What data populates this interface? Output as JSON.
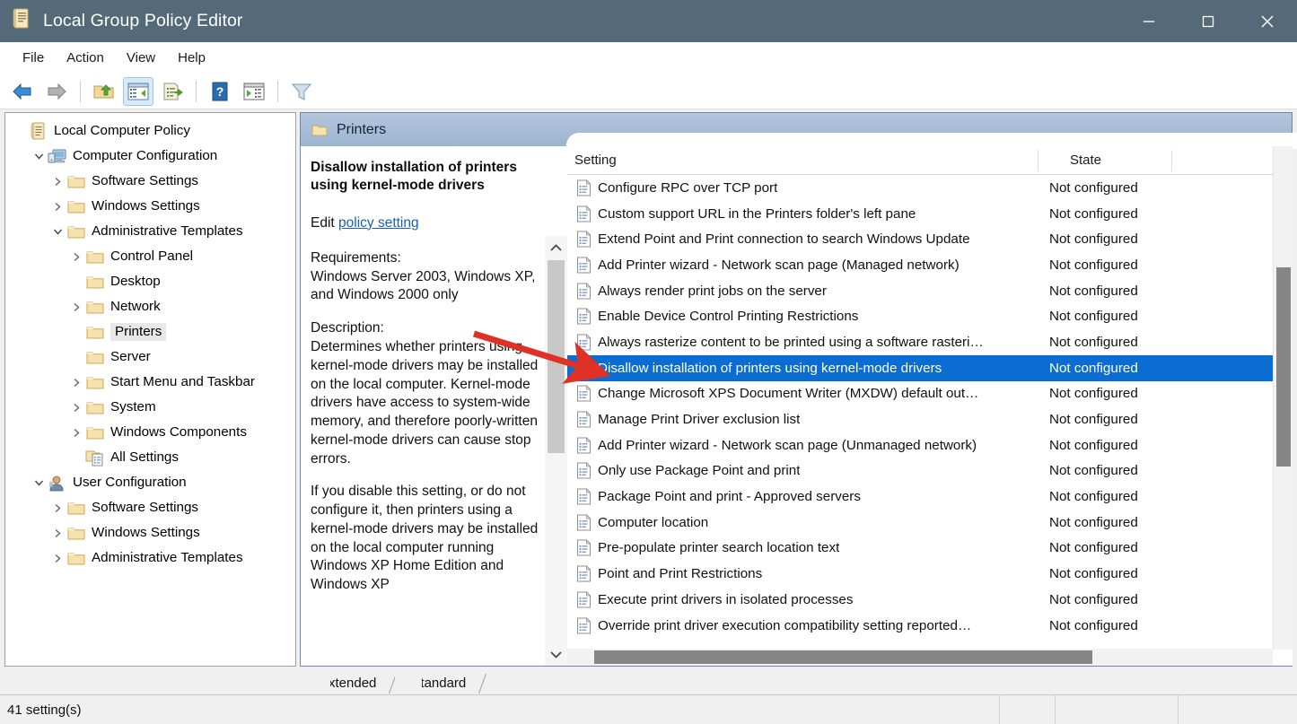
{
  "window": {
    "title": "Local Group Policy Editor",
    "icon": "policy-document-icon",
    "controls": {
      "minimize": "—",
      "maximize": "☐",
      "close": "✕"
    },
    "titlebar_color": "#546a78"
  },
  "menubar": {
    "items": [
      "File",
      "Action",
      "View",
      "Help"
    ]
  },
  "toolbar": {
    "items": [
      {
        "name": "back-icon",
        "tip": "Back"
      },
      {
        "name": "forward-icon",
        "tip": "Forward"
      },
      {
        "name": "up-one-level-icon",
        "tip": "Up one level"
      },
      {
        "name": "show-hide-console-tree-icon",
        "tip": "Show/Hide Console Tree",
        "active": true
      },
      {
        "name": "export-list-icon",
        "tip": "Export List"
      },
      {
        "name": "help-icon",
        "tip": "Help"
      },
      {
        "name": "show-action-pane-icon",
        "tip": "Show/Hide Action Pane"
      },
      {
        "name": "filter-icon",
        "tip": "Filter Options"
      }
    ]
  },
  "tree": {
    "nodes": [
      {
        "label": "Local Computer Policy",
        "indent": 0,
        "twist": "",
        "icon": "policy-icon",
        "selected": false
      },
      {
        "label": "Computer Configuration",
        "indent": 1,
        "twist": "expanded",
        "icon": "computer-icon",
        "selected": false
      },
      {
        "label": "Software Settings",
        "indent": 2,
        "twist": "collapsed",
        "icon": "folder-icon",
        "selected": false
      },
      {
        "label": "Windows Settings",
        "indent": 2,
        "twist": "collapsed",
        "icon": "folder-icon",
        "selected": false
      },
      {
        "label": "Administrative Templates",
        "indent": 2,
        "twist": "expanded",
        "icon": "folder-icon",
        "selected": false
      },
      {
        "label": "Control Panel",
        "indent": 3,
        "twist": "collapsed",
        "icon": "folder-icon",
        "selected": false
      },
      {
        "label": "Desktop",
        "indent": 3,
        "twist": "",
        "icon": "folder-icon",
        "selected": false
      },
      {
        "label": "Network",
        "indent": 3,
        "twist": "collapsed",
        "icon": "folder-icon",
        "selected": false
      },
      {
        "label": "Printers",
        "indent": 3,
        "twist": "",
        "icon": "folder-icon",
        "selected": true
      },
      {
        "label": "Server",
        "indent": 3,
        "twist": "",
        "icon": "folder-icon",
        "selected": false
      },
      {
        "label": "Start Menu and Taskbar",
        "indent": 3,
        "twist": "collapsed",
        "icon": "folder-icon",
        "selected": false
      },
      {
        "label": "System",
        "indent": 3,
        "twist": "collapsed",
        "icon": "folder-icon",
        "selected": false
      },
      {
        "label": "Windows Components",
        "indent": 3,
        "twist": "collapsed",
        "icon": "folder-icon",
        "selected": false
      },
      {
        "label": "All Settings",
        "indent": 3,
        "twist": "",
        "icon": "all-settings-icon",
        "selected": false
      },
      {
        "label": "User Configuration",
        "indent": 1,
        "twist": "expanded",
        "icon": "user-icon",
        "selected": false
      },
      {
        "label": "Software Settings",
        "indent": 2,
        "twist": "collapsed",
        "icon": "folder-icon",
        "selected": false
      },
      {
        "label": "Windows Settings",
        "indent": 2,
        "twist": "collapsed",
        "icon": "folder-icon",
        "selected": false
      },
      {
        "label": "Administrative Templates",
        "indent": 2,
        "twist": "collapsed",
        "icon": "folder-icon",
        "selected": false
      }
    ]
  },
  "console": {
    "header": {
      "title": "Printers",
      "icon": "folder-icon"
    },
    "description": {
      "policy_title": "Disallow installation of printers using kernel-mode drivers",
      "edit_prefix": "Edit ",
      "edit_link": "policy setting",
      "requirements_label": "Requirements:",
      "requirements_text": "Windows Server 2003, Windows XP, and Windows 2000 only",
      "description_label": "Description:",
      "paragraph_1": "Determines whether printers using kernel-mode drivers may be installed on the local computer. Kernel-mode drivers have access to system-wide memory, and therefore poorly-written kernel-mode drivers can cause stop errors.",
      "paragraph_2": "If you disable this setting, or do not configure it, then printers using a kernel-mode drivers may be installed on the local computer running Windows XP Home Edition and Windows XP"
    },
    "list": {
      "columns": [
        "Setting",
        "State"
      ],
      "selected_index": 7,
      "selection_color": "#0b6dd1",
      "rows": [
        {
          "setting": "Configure RPC over TCP port",
          "state": "Not configured"
        },
        {
          "setting": "Custom support URL in the Printers folder's left pane",
          "state": "Not configured"
        },
        {
          "setting": "Extend Point and Print connection to search Windows Update",
          "state": "Not configured"
        },
        {
          "setting": "Add Printer wizard - Network scan page (Managed network)",
          "state": "Not configured"
        },
        {
          "setting": "Always render print jobs on the server",
          "state": "Not configured"
        },
        {
          "setting": "Enable Device Control Printing Restrictions",
          "state": "Not configured"
        },
        {
          "setting": "Always rasterize content to be printed using a software rasteri…",
          "state": "Not configured"
        },
        {
          "setting": "Disallow installation of printers using kernel-mode drivers",
          "state": "Not configured"
        },
        {
          "setting": "Change Microsoft XPS Document Writer (MXDW) default out…",
          "state": "Not configured"
        },
        {
          "setting": "Manage Print Driver exclusion list",
          "state": "Not configured"
        },
        {
          "setting": "Add Printer wizard - Network scan page (Unmanaged network)",
          "state": "Not configured"
        },
        {
          "setting": "Only use Package Point and print",
          "state": "Not configured"
        },
        {
          "setting": "Package Point and print - Approved servers",
          "state": "Not configured"
        },
        {
          "setting": "Computer location",
          "state": "Not configured"
        },
        {
          "setting": "Pre-populate printer search location text",
          "state": "Not configured"
        },
        {
          "setting": "Point and Print Restrictions",
          "state": "Not configured"
        },
        {
          "setting": "Execute print drivers in isolated processes",
          "state": "Not configured"
        },
        {
          "setting": "Override print driver execution compatibility setting reported…",
          "state": "Not configured"
        }
      ]
    },
    "tabs": [
      {
        "label": "Extended",
        "active": false
      },
      {
        "label": "Standard",
        "active": true
      }
    ]
  },
  "statusbar": {
    "text": "41 setting(s)"
  },
  "annotation": {
    "arrow_color": "#e03127",
    "points_to": "Disallow installation of printers using kernel-mode drivers"
  }
}
